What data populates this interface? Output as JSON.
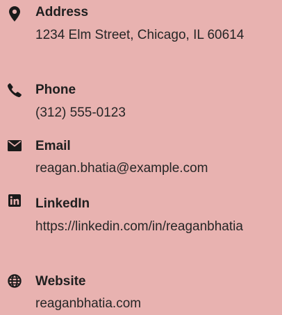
{
  "contacts": [
    {
      "icon": "map-marker-icon",
      "label": "Address",
      "value": "1234 Elm Street, Chicago, IL 60614"
    },
    {
      "icon": "phone-icon",
      "label": "Phone",
      "value": "(312) 555-0123"
    },
    {
      "icon": "envelope-icon",
      "label": "Email",
      "value": "reagan.bhatia@example.com"
    },
    {
      "icon": "linkedin-icon",
      "label": "LinkedIn",
      "value": "https://linkedin.com/in/reaganbhatia"
    },
    {
      "icon": "globe-icon",
      "label": "Website",
      "value": "reaganbhatia.com"
    }
  ],
  "colors": {
    "background": "#e8b2b0",
    "text": "#222222",
    "icon": "#1a1a1a"
  }
}
